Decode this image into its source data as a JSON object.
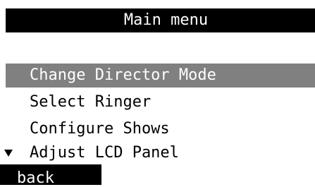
{
  "header": {
    "title": "Main menu"
  },
  "menu": {
    "items": [
      {
        "label": "Change Director Mode",
        "selected": true
      },
      {
        "label": "Select Ringer",
        "selected": false
      },
      {
        "label": "Configure Shows",
        "selected": false
      },
      {
        "label": "Adjust LCD Panel",
        "selected": false,
        "has_more_indicator": true
      }
    ]
  },
  "footer": {
    "back_label": "back"
  },
  "icons": {
    "more_indicator": "triangle-down-icon"
  },
  "colors": {
    "title_bg": "#000000",
    "selected_bg": "#808080",
    "back_bg": "#000000"
  }
}
